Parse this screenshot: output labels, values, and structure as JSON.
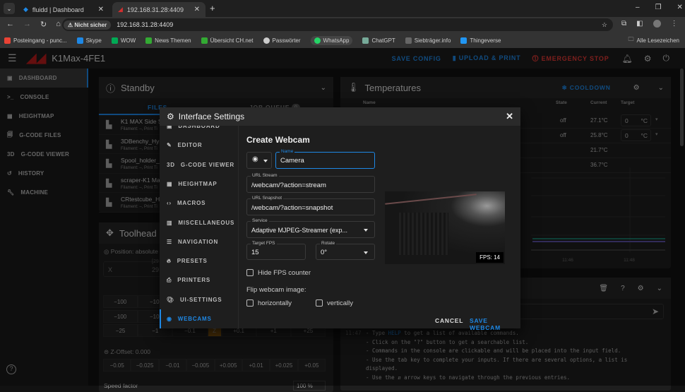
{
  "browser": {
    "tabs": [
      {
        "title": "fluidd | Dashboard"
      },
      {
        "title": "192.168.31.28:4409",
        "active": true
      }
    ],
    "security_label": "Nicht sicher",
    "url": "192.168.31.28:4409",
    "bookmarks": [
      "Posteingang - punc...",
      "Skype",
      "WOW",
      "News Themen",
      "Übersicht CH.net",
      "Passwörter",
      "WhatsApp",
      "ChatGPT",
      "Siebträger.info",
      "Thingeverse"
    ],
    "all_bookmarks": "Alle Lesezeichen"
  },
  "app": {
    "title": "K1Max-4FE1",
    "save_config": "SAVE CONFIG",
    "upload_print": "UPLOAD & PRINT",
    "emergency_stop": "EMERGENCY STOP",
    "accent": "#1e88e5",
    "danger": "#e53935"
  },
  "sidebar": {
    "items": [
      {
        "label": "DASHBOARD",
        "icon": "monitor-icon"
      },
      {
        "label": "CONSOLE",
        "icon": "terminal-icon"
      },
      {
        "label": "HEIGHTMAP",
        "icon": "grid-icon"
      },
      {
        "label": "G-CODE FILES",
        "icon": "file-icon"
      },
      {
        "label": "G-CODE VIEWER",
        "icon": "3d-icon"
      },
      {
        "label": "HISTORY",
        "icon": "history-icon"
      },
      {
        "label": "MACHINE",
        "icon": "wrench-icon"
      }
    ]
  },
  "status": {
    "title": "Standby",
    "tab_files": "FILES",
    "tab_queue": "JOB QUEUE",
    "queue_count": "0",
    "files": [
      {
        "name": "K1 MAX Side Sp",
        "meta": "Filament: –, Print Ti"
      },
      {
        "name": "3DBenchy_Hype",
        "meta": "Filament: –, Print Ti"
      },
      {
        "name": "Spool_holder_H",
        "meta": "Filament: –, Print Ti"
      },
      {
        "name": "scraper-K1 Max",
        "meta": "Filament: –, Print Ti"
      },
      {
        "name": "CRtestcube_Hy",
        "meta": "Filament: –, Print Ti"
      }
    ]
  },
  "toolhead": {
    "title": "Toolhead",
    "position": "Position: absolute",
    "axis": "X",
    "axis_range": "[29",
    "axis_value": "29",
    "row1": [
      "−100",
      "−10"
    ],
    "row2": [
      "−100",
      "−10"
    ],
    "row3": [
      "−25",
      "−1",
      "−0.1",
      "Z",
      "+0.1",
      "+1",
      "+25"
    ],
    "zoffset": "Z-Offset: 0.000",
    "zrow": [
      "−0.05",
      "−0.025",
      "−0.01",
      "−0.005",
      "+0.005",
      "+0.01",
      "+0.025",
      "+0.05"
    ],
    "speed": "Speed factor",
    "speed_value": "100",
    "speed_unit": "%"
  },
  "temps": {
    "title": "Temperatures",
    "cooldown": "COOLDOWN",
    "headers": [
      "Name",
      "State",
      "Current",
      "Target"
    ],
    "rows": [
      {
        "state": "off",
        "current": "27.1°C",
        "target": "0",
        "unit": "°C"
      },
      {
        "state": "off",
        "current": "25.8°C",
        "target": "0",
        "unit": "°C"
      },
      {
        "state": "",
        "current": "21.7°C"
      },
      {
        "state": "",
        "current": "36.7°C"
      }
    ],
    "chart_ticks": [
      "11:46",
      "11:48"
    ]
  },
  "console": {
    "time": "11:47",
    "lines": [
      [
        "- Type ",
        "HELP",
        " to get a list of available commands."
      ],
      "- Click on the \"?\" button to get a searchable list.",
      "- Commands in the console are clickable and will be placed into the input field.",
      "- Use the tab key to complete your inputs. If there are several options, a list is",
      "displayed.",
      "- Use the ⇵ arrow keys to navigate through the previous entries."
    ]
  },
  "dialog": {
    "title": "Interface Settings",
    "nav": [
      {
        "label": "DASHBOARD"
      },
      {
        "label": "EDITOR"
      },
      {
        "label": "G-CODE VIEWER"
      },
      {
        "label": "HEIGHTMAP"
      },
      {
        "label": "MACROS"
      },
      {
        "label": "MISCELLANEOUS"
      },
      {
        "label": "NAVIGATION"
      },
      {
        "label": "PRESETS"
      },
      {
        "label": "PRINTERS"
      },
      {
        "label": "UI-SETTINGS"
      },
      {
        "label": "WEBCAMS",
        "active": true
      }
    ],
    "form": {
      "heading": "Create Webcam",
      "name_label": "Name",
      "name_value": "Camera",
      "stream_label": "URL Stream",
      "stream_value": "/webcam/?action=stream",
      "snapshot_label": "URL Snapshot",
      "snapshot_value": "/webcam/?action=snapshot",
      "service_label": "Service",
      "service_value": "Adaptive MJPEG-Streamer (exp...",
      "fps_label": "Target FPS",
      "fps_value": "15",
      "rotate_label": "Rotate",
      "rotate_value": "0°",
      "hide_fps": "Hide FPS counter",
      "hide_fps_checked": false,
      "flip_label": "Flip webcam image:",
      "flip_h": "horizontally",
      "flip_h_checked": false,
      "flip_v": "vertically",
      "flip_v_checked": false,
      "fps_badge": "FPS: 14",
      "cancel": "CANCEL",
      "save": "SAVE WEBCAM"
    }
  }
}
